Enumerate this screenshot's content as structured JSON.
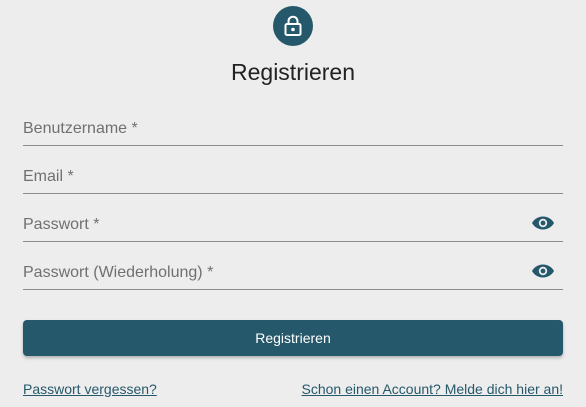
{
  "header": {
    "icon": "lock-icon",
    "title": "Registrieren"
  },
  "form": {
    "fields": [
      {
        "label": "Benutzername *",
        "value": "",
        "type": "text"
      },
      {
        "label": "Email *",
        "value": "",
        "type": "email"
      },
      {
        "label": "Passwort *",
        "value": "",
        "type": "password",
        "toggle_icon": "eye-icon"
      },
      {
        "label": "Passwort (Wiederholung) *",
        "value": "",
        "type": "password",
        "toggle_icon": "eye-icon"
      }
    ],
    "submit_label": "Registrieren"
  },
  "links": {
    "forgot_password": "Passwort vergessen?",
    "login": "Schon einen Account? Melde dich hier an!"
  },
  "colors": {
    "accent": "#25586a",
    "background": "#ededed",
    "label": "#707070",
    "underline": "#8c8c8c"
  }
}
